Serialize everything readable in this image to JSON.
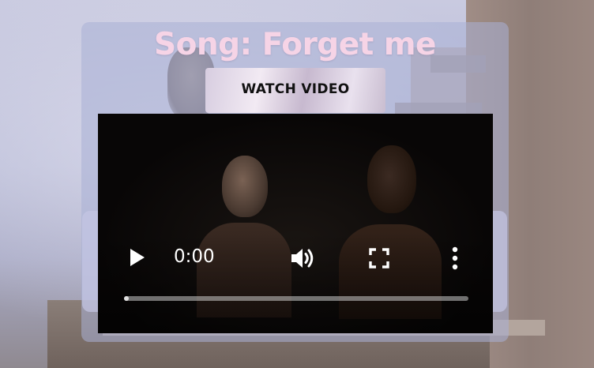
{
  "song": {
    "title": "Song: Forget me",
    "watch_button_label": "WATCH VIDEO"
  },
  "player": {
    "current_time": "0:00",
    "progress_fraction": 0.012,
    "icons": {
      "play": "play-icon",
      "volume": "volume-icon",
      "fullscreen": "fullscreen-icon",
      "more": "more-vertical-icon"
    }
  },
  "colors": {
    "title": "#f6d4e6",
    "card": "#aab0d6",
    "player_bg": "#070707"
  }
}
